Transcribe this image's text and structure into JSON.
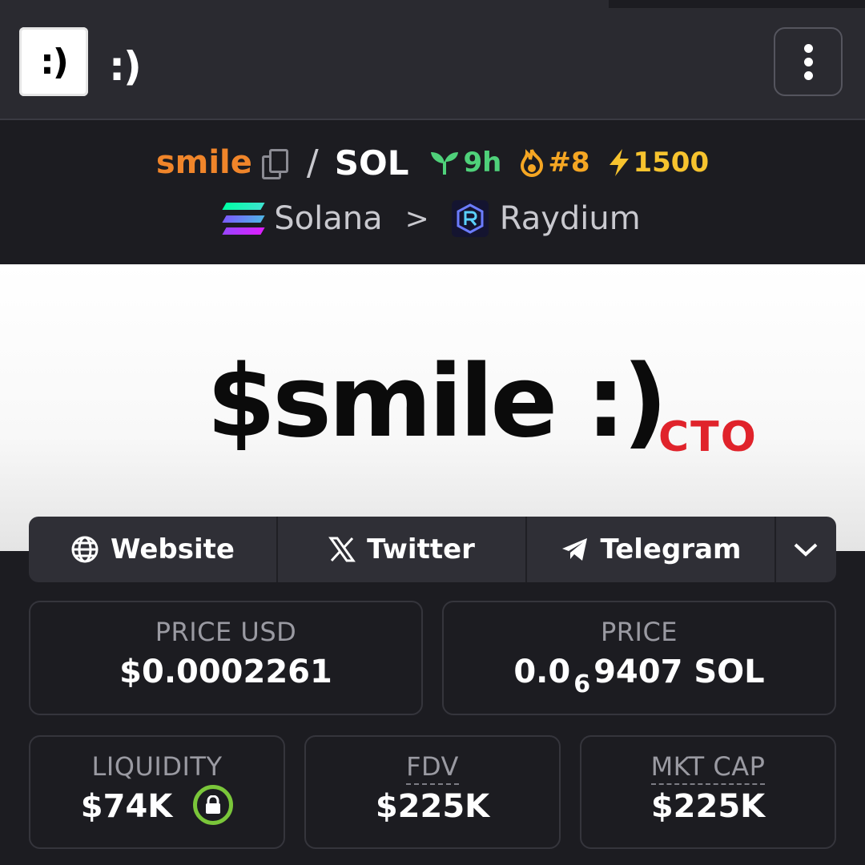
{
  "app": {
    "icon_label": ":)",
    "name": ":)"
  },
  "pair": {
    "base": "smile",
    "separator": "/",
    "quote": "SOL",
    "age": "9h",
    "rank": "#8",
    "boosts": "1500",
    "chain": "Solana",
    "chevron": ">",
    "dex": "Raydium",
    "colors": {
      "base": "#f0852a",
      "age": "#4fd17a",
      "rank": "#f5a623",
      "boost": "#f7c32e"
    }
  },
  "banner": {
    "title": "$smile :)",
    "tag": "CTO"
  },
  "links": [
    {
      "label": "Website",
      "icon": "globe-icon"
    },
    {
      "label": "Twitter",
      "icon": "x-logo-icon"
    },
    {
      "label": "Telegram",
      "icon": "telegram-icon"
    }
  ],
  "stats": {
    "price_usd": {
      "label": "PRICE USD",
      "value": "$0.0002261"
    },
    "price_native": {
      "label": "PRICE",
      "prefix": "0.0",
      "zeros": "6",
      "suffix": "9407 SOL"
    },
    "liquidity": {
      "label": "LIQUIDITY",
      "value": "$74K",
      "locked_color": "#7ac63a"
    },
    "fdv": {
      "label": "FDV",
      "value": "$225K"
    },
    "mkt_cap": {
      "label": "MKT CAP",
      "value": "$225K"
    }
  }
}
